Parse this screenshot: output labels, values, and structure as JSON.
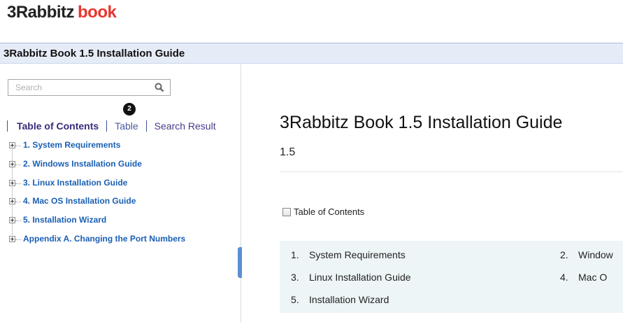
{
  "app": {
    "logo_part1": "3Rabbitz",
    "logo_part2": "book"
  },
  "titlebar": {
    "title": "3Rabbitz Book 1.5 Installation Guide"
  },
  "sidebar": {
    "search_placeholder": "Search",
    "badge": "2",
    "tabs": [
      {
        "label": "Table of Contents"
      },
      {
        "label": "Table"
      },
      {
        "label": "Search Result"
      }
    ],
    "toc": [
      {
        "label": "1. System Requirements"
      },
      {
        "label": "2. Windows Installation Guide"
      },
      {
        "label": "3. Linux Installation Guide"
      },
      {
        "label": "4. Mac OS Installation Guide"
      },
      {
        "label": "5. Installation Wizard"
      },
      {
        "label": "Appendix A. Changing the Port Numbers"
      }
    ]
  },
  "main": {
    "title": "3Rabbitz Book 1.5 Installation Guide",
    "version": "1.5",
    "toc_checkbox_label": "Table of Contents",
    "toc_items": [
      {
        "num": "1.",
        "label": "System Requirements"
      },
      {
        "num": "2.",
        "label": "Window"
      },
      {
        "num": "3.",
        "label": "Linux Installation Guide"
      },
      {
        "num": "4.",
        "label": "Mac O"
      },
      {
        "num": "5.",
        "label": "Installation Wizard"
      }
    ]
  },
  "colors": {
    "logo_accent": "#e8352e",
    "titlebar_bg": "#e6ecf7",
    "link": "#1a5fb4",
    "toc_panel_bg": "#eef5f7"
  }
}
